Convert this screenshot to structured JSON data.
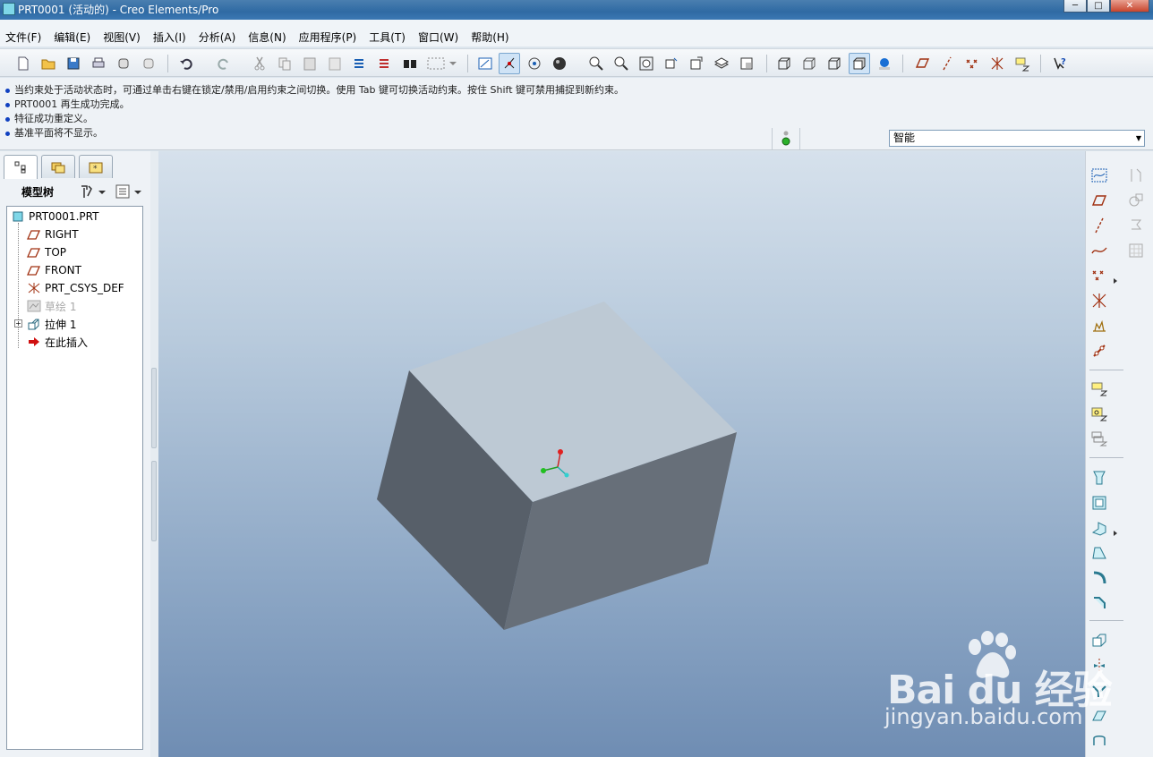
{
  "window": {
    "title": "PRT0001 (活动的) - Creo Elements/Pro",
    "buttons": [
      "─",
      "□",
      "✕"
    ]
  },
  "menu": [
    "文件(F)",
    "编辑(E)",
    "视图(V)",
    "插入(I)",
    "分析(A)",
    "信息(N)",
    "应用程序(P)",
    "工具(T)",
    "窗口(W)",
    "帮助(H)"
  ],
  "messages": [
    "当约束处于活动状态时，可通过单击右键在锁定/禁用/启用约束之间切换。使用 Tab 键可切换活动约束。按住 Shift 键可禁用捕捉到新约束。",
    "PRT0001 再生成功完成。",
    "特征成功重定义。",
    "基准平面将不显示。"
  ],
  "filter": {
    "selected": "智能"
  },
  "model_tree": {
    "title": "模型树",
    "items": [
      {
        "label": "PRT0001.PRT",
        "icon": "part-icon"
      },
      {
        "label": "RIGHT",
        "icon": "datum-plane-icon"
      },
      {
        "label": "TOP",
        "icon": "datum-plane-icon"
      },
      {
        "label": "FRONT",
        "icon": "datum-plane-icon"
      },
      {
        "label": "PRT_CSYS_DEF",
        "icon": "coordinate-system-icon"
      },
      {
        "label": "草绘 1",
        "icon": "sketch-icon"
      },
      {
        "label": "拉伸 1",
        "icon": "extrude-icon"
      },
      {
        "label": "在此插入",
        "icon": "insert-here-arrow-icon"
      }
    ]
  },
  "watermark": {
    "brand": "Bai du 经验",
    "url": "jingyan.baidu.com"
  },
  "colors": {
    "titlebar": "#2f6aa3",
    "viewport_top": "#d6e1ec",
    "viewport_bottom": "#6f8db3",
    "box_top": "#bdc9d4",
    "box_left": "#575f69",
    "box_right": "#676f79"
  }
}
